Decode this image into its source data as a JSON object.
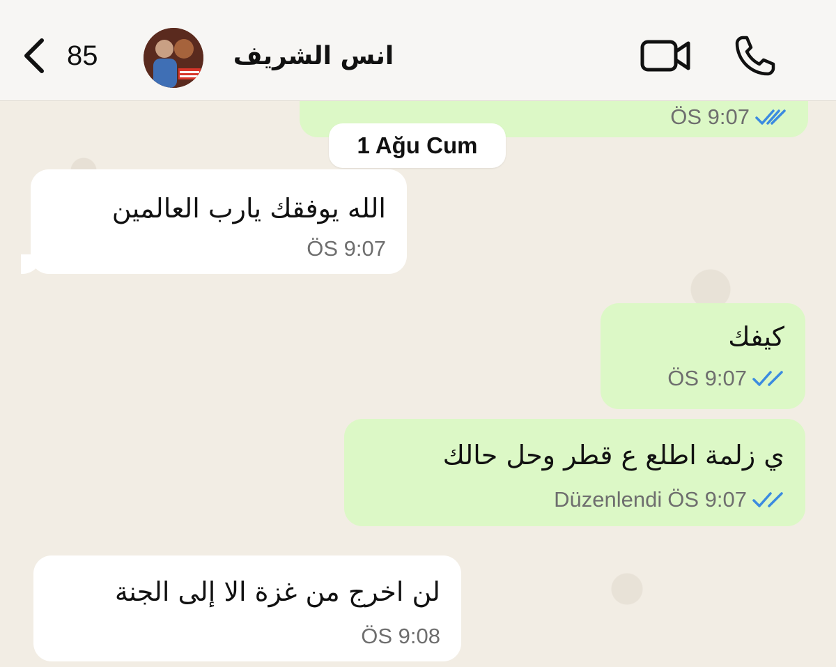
{
  "header": {
    "back_count": "85",
    "contact_name": "انس الشريف"
  },
  "date_separator": "1 Ağu Cum",
  "messages": [
    {
      "direction": "out",
      "text": "",
      "time": "ÖS 9:07",
      "status": "read"
    },
    {
      "direction": "in",
      "text": "الله يوفقك يارب العالمين",
      "time": "ÖS 9:07"
    },
    {
      "direction": "out",
      "text": "كيفك",
      "time": "ÖS 9:07",
      "status": "read"
    },
    {
      "direction": "out",
      "text": "ي زلمة اطلع ع قطر وحل حالك",
      "edited_label": "Düzenlendi",
      "time": "ÖS 9:07",
      "status": "read"
    },
    {
      "direction": "in",
      "text": "لن اخرج من غزة الا إلى الجنة",
      "time": "ÖS 9:08"
    }
  ],
  "colors": {
    "incoming_bubble": "#ffffff",
    "outgoing_bubble": "#dcf8c6",
    "read_ticks": "#3b8be0",
    "chat_background": "#f2ede4"
  },
  "icons": [
    "chevron-left-icon",
    "video-camera-icon",
    "phone-icon",
    "double-check-icon"
  ]
}
